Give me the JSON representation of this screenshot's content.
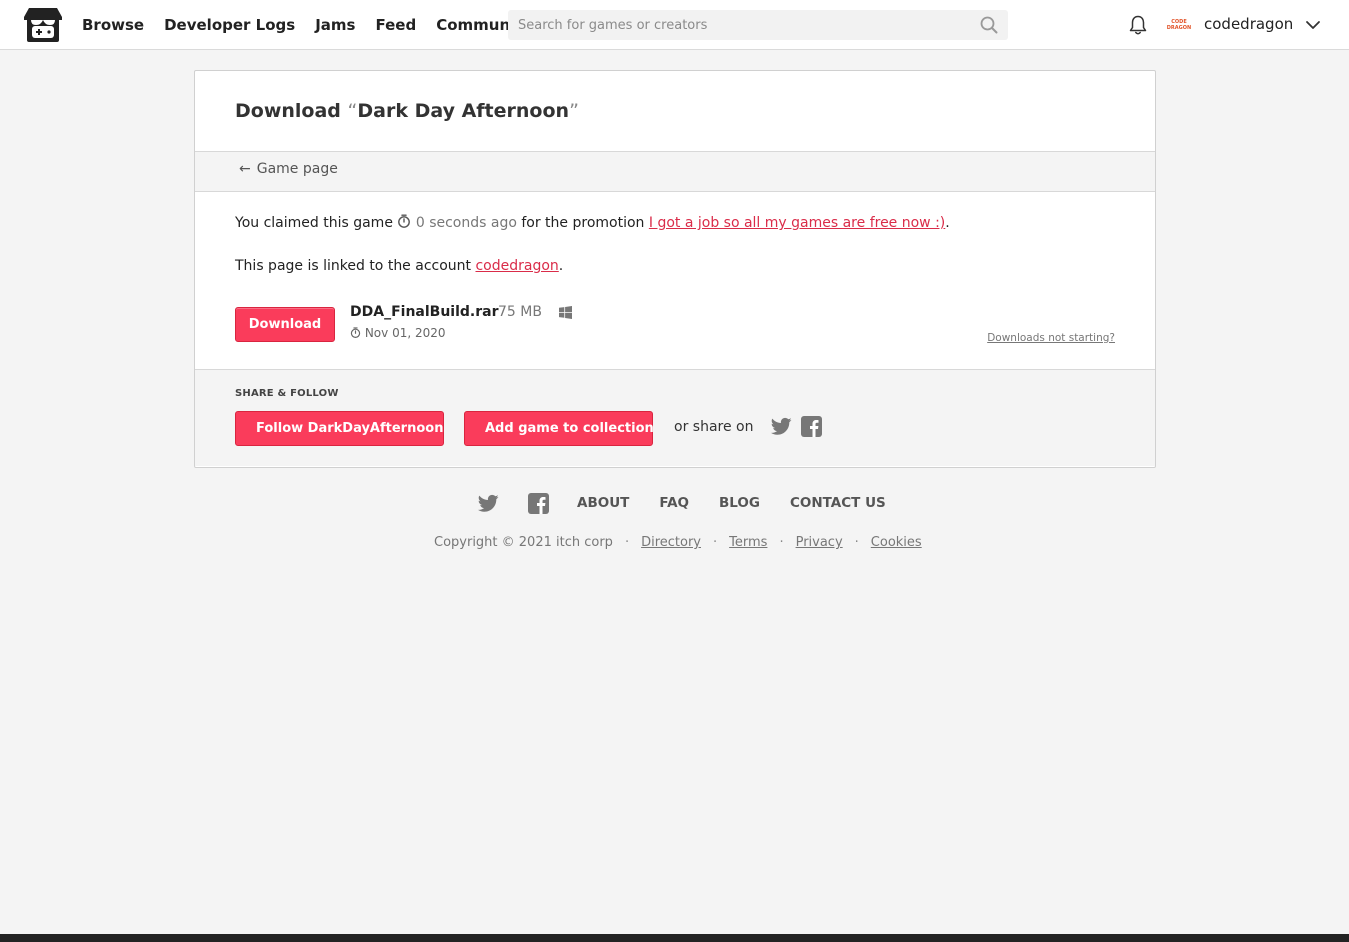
{
  "header": {
    "nav": [
      "Browse",
      "Developer Logs",
      "Jams",
      "Feed",
      "Community"
    ],
    "search_placeholder": "Search for games or creators",
    "avatar_text": [
      "CODE",
      "DRAGON"
    ],
    "username": "codedragon"
  },
  "page": {
    "title_prefix": "Download ",
    "open_quote": "“",
    "game_title": "Dark Day Afternoon",
    "close_quote": "”",
    "back_arrow": "←",
    "back_label": "Game page",
    "claim_before": "You claimed this game ",
    "claim_time": "0 seconds ago",
    "claim_mid": " for the promotion ",
    "promotion_link": "I got a job so all my games are free now :)",
    "claim_end": ".",
    "linked_before": "This page is linked to the account ",
    "account_link": "codedragon",
    "linked_end": "."
  },
  "file": {
    "download_label": "Download",
    "name": "DDA_FinalBuild.rar",
    "size": "75 MB",
    "platform_icon": "windows-icon",
    "date": "Nov 01, 2020",
    "help_link": "Downloads not starting?"
  },
  "share": {
    "heading": "SHARE & FOLLOW",
    "follow_label": "Follow DarkDayAfternoon",
    "collection_label": "Add game to collection",
    "share_text": "or share on"
  },
  "footer": {
    "links": [
      "ABOUT",
      "FAQ",
      "BLOG",
      "CONTACT US"
    ],
    "copyright": "Copyright © 2021 itch corp",
    "separator": "·",
    "legal_links": [
      "Directory",
      "Terms",
      "Privacy",
      "Cookies"
    ]
  },
  "colors": {
    "accent": "#fa3c5b",
    "link": "#da2c49",
    "avatar": "#e2552b"
  }
}
